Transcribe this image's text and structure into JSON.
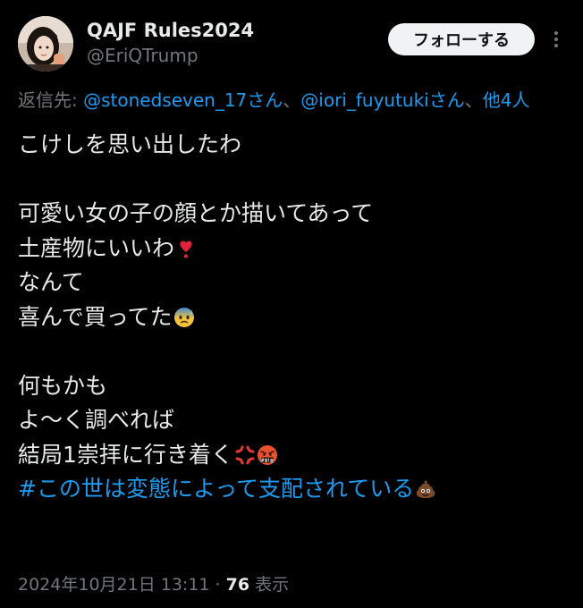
{
  "author": {
    "display_name": "QAJF Rules2024",
    "handle": "@EriQTrump",
    "avatar_icon": "profile-photo"
  },
  "actions": {
    "follow_label": "フォローする",
    "more_icon": "more-dots-icon"
  },
  "reply": {
    "prefix": "返信先: ",
    "mention1": "@stonedseven_17さん",
    "sep": "、",
    "mention2": "@iori_fuyutukiさん",
    "sep2": "、",
    "others": "他4人"
  },
  "post": {
    "lines": [
      "こけしを思い出したわ",
      "",
      "可愛い女の子の顔とか描いてあって",
      "土産物にいいわ",
      "なんて",
      "喜んで買ってた",
      "",
      "何もかも",
      "よ〜く調べれば",
      "結局1崇拝に行き着く",
      "#この世は変態によって支配されている"
    ],
    "emojis": {
      "heart": "heart-exclamation-emoji",
      "fear": "anxious-sweat-emoji",
      "anger": "anger-symbol-emoji",
      "cursing": "cursing-face-emoji",
      "poop": "pile-of-poo-emoji"
    }
  },
  "meta": {
    "timestamp": "2024年10月21日 13:11",
    "separator": " · ",
    "views_count": "76",
    "views_label": " 表示"
  },
  "colors": {
    "background": "#000000",
    "text": "#e7e9ea",
    "muted": "#71767b",
    "link": "#1d9bf0",
    "button_bg": "#eff3f4"
  }
}
